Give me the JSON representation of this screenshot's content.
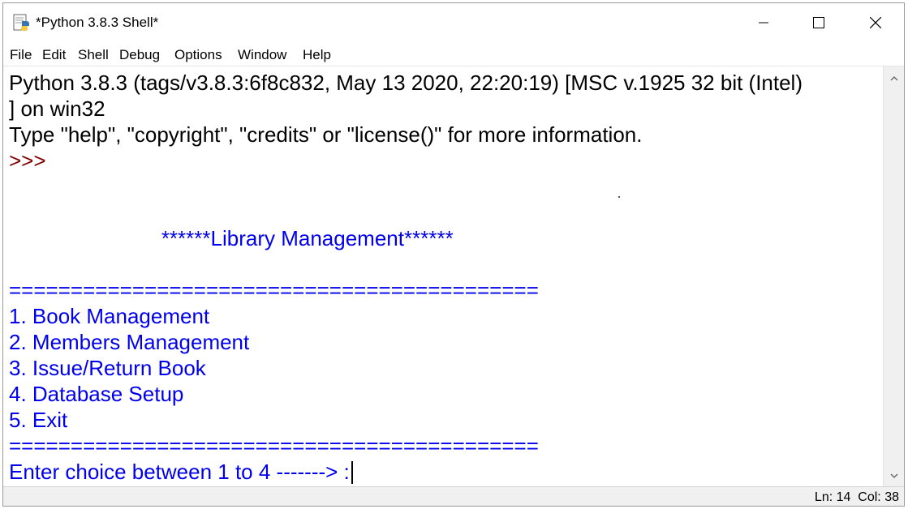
{
  "window": {
    "title": "*Python 3.8.3 Shell*",
    "icon": "python-idle-icon",
    "controls": [
      "minimize-icon",
      "maximize-icon",
      "close-icon"
    ]
  },
  "menu": {
    "items": [
      "File",
      "Edit",
      "Shell",
      "Debug",
      "Options",
      "Window",
      "Help"
    ]
  },
  "shell": {
    "lines": [
      {
        "text": "Python 3.8.3 (tags/v3.8.3:6f8c832, May 13 2020, 22:20:19) [MSC v.1925 32 bit (Intel)",
        "color": "black"
      },
      {
        "text": "] on win32",
        "color": "black"
      },
      {
        "text": "Type \"help\", \"copyright\", \"credits\" or \"license()\" for more information.",
        "color": "black"
      },
      {
        "text": ">>> ",
        "color": "prompt"
      },
      {
        "text": "",
        "color": "blue"
      },
      {
        "text": "",
        "color": "blue"
      },
      {
        "text": "                          ******Library Management******",
        "color": "blue"
      },
      {
        "text": "",
        "color": "blue"
      },
      {
        "text": "===========================================",
        "color": "blue"
      },
      {
        "text": "1. Book Management",
        "color": "blue"
      },
      {
        "text": "2. Members Management",
        "color": "blue"
      },
      {
        "text": "3. Issue/Return Book",
        "color": "blue"
      },
      {
        "text": "4. Database Setup",
        "color": "blue"
      },
      {
        "text": "5. Exit",
        "color": "blue"
      },
      {
        "text": "===========================================",
        "color": "blue"
      },
      {
        "text": "Enter choice between 1 to 4 -------> :",
        "color": "blue"
      }
    ]
  },
  "status": {
    "line_label": "Ln: 14",
    "col_label": "Col: 38"
  },
  "colors": {
    "black": "#000000",
    "blue": "#0000ee",
    "prompt": "#800000"
  }
}
